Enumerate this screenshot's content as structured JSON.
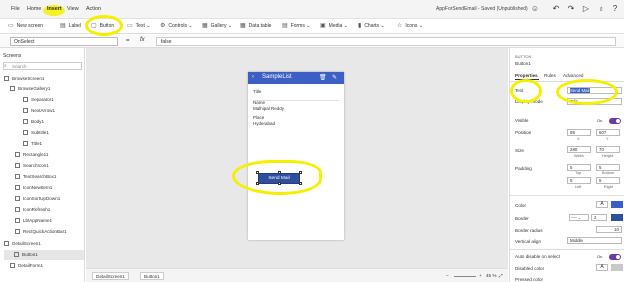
{
  "menu": {
    "items": [
      "File",
      "Home",
      "Insert",
      "View",
      "Action"
    ]
  },
  "app_title": "AppForSendEmail - Saved (Unpublished)",
  "ribbon": {
    "items": [
      "New screen",
      "Label",
      "Button",
      "Text",
      "Controls",
      "Gallery",
      "Data table",
      "Forms",
      "Media",
      "Charts",
      "Icons"
    ]
  },
  "formula": {
    "property": "OnSelect",
    "fx": "fx",
    "value": "false"
  },
  "left": {
    "header": "Screens",
    "search_placeholder": "Search",
    "tree": [
      "BrowseScreen1",
      "BrowseGallery1",
      "Separator1",
      "NextArrow1",
      "Body1",
      "Subtitle1",
      "Title1",
      "Rectangle11",
      "SearchIcon1",
      "TextSearchBox1",
      "IconNewItem1",
      "IconSortUpDown1",
      "IconRefresh1",
      "LblAppName1",
      "RectQuickActionBar1",
      "DetailScreen1",
      "Button1",
      "DetailForm1"
    ]
  },
  "phone": {
    "title": "SampleList",
    "fields": [
      {
        "label": "Title",
        "value": ""
      },
      {
        "label": "Name",
        "value": "Malhipal Reddy"
      },
      {
        "label": "Place",
        "value": "Hyderabad"
      }
    ],
    "button_label": "Send Mail"
  },
  "bottom": {
    "crumbs": [
      "DetailScreen1",
      "Button1"
    ],
    "zoom": "45 %"
  },
  "right": {
    "type": "BUTTON",
    "name": "Button1",
    "tabs": [
      "Properties",
      "Rules",
      "Advanced"
    ],
    "text_label": "Text",
    "text_value": "Send Mail",
    "display_mode_label": "Display mode",
    "display_mode_value": "Edit",
    "visible_label": "Visible",
    "visible_state": "On",
    "position_label": "Position",
    "pos_x": "88",
    "pos_y": "607",
    "x_label": "X",
    "y_label": "Y",
    "size_label": "Size",
    "width": "280",
    "height": "70",
    "width_label": "Width",
    "height_label": "Height",
    "padding_label": "Padding",
    "pad_top": "5",
    "pad_bottom": "5",
    "pad_left": "5",
    "pad_right": "5",
    "top_label": "Top",
    "bottom_label": "Bottom",
    "left_label": "Left",
    "right_label": "Right",
    "color_label": "Color",
    "border_label": "Border",
    "border_value": "2",
    "border_radius_label": "Border radius",
    "border_radius_value": "10",
    "valign_label": "Vertical align",
    "valign_value": "Middle",
    "auto_disable_label": "Auto disable on select",
    "auto_disable_state": "On",
    "disabled_color_label": "Disabled color",
    "pressed_color_label": "Pressed color"
  },
  "colors": {
    "accent": "#3b5fc4",
    "highlight": "#f4f000",
    "toggle": "#6a3aa8"
  }
}
